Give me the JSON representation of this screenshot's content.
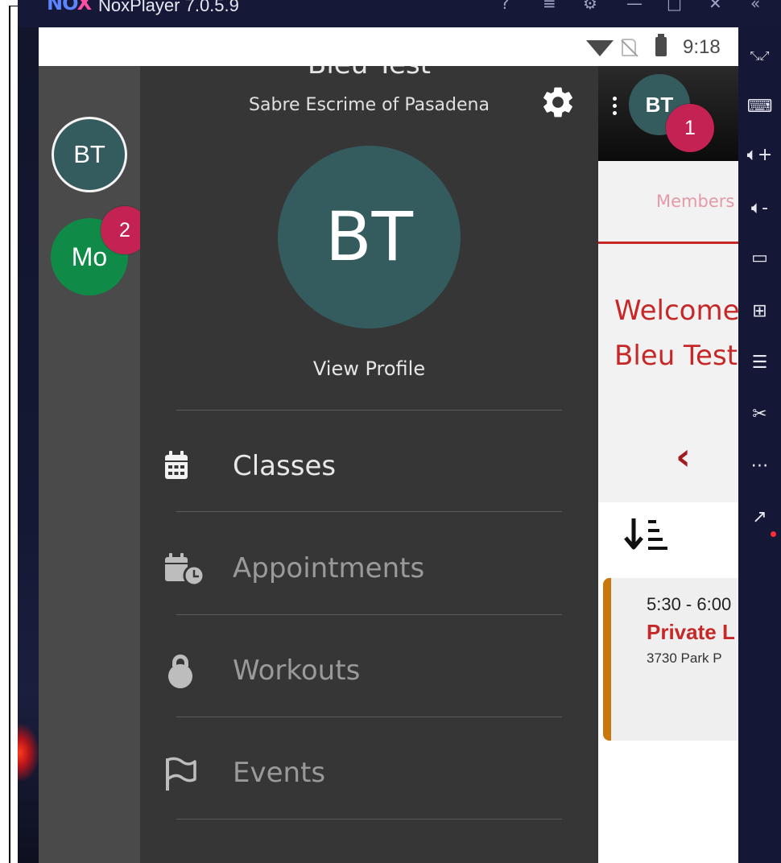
{
  "window": {
    "app_title": "NoxPlayer 7.0.5.9"
  },
  "status_bar": {
    "time": "9:18"
  },
  "accounts": [
    {
      "initials": "BT",
      "color": "#345b5e"
    },
    {
      "initials": "Mo",
      "color": "#0f8a47",
      "badge": "2"
    }
  ],
  "drawer": {
    "user_name": "Bleu Test",
    "organization": "Sabre Escrime of Pasadena",
    "avatar_initials": "BT",
    "view_profile": "View Profile",
    "menu": [
      {
        "label": "Classes",
        "icon": "calendar-icon",
        "active": true
      },
      {
        "label": "Appointments",
        "icon": "calendar-clock-icon",
        "active": false
      },
      {
        "label": "Workouts",
        "icon": "kettlebell-icon",
        "active": false
      },
      {
        "label": "Events",
        "icon": "flag-icon",
        "active": false
      }
    ]
  },
  "header": {
    "avatar_initials": "BT",
    "notification_count": "1"
  },
  "page": {
    "tab_label": "Members",
    "welcome_line1": "Welcome",
    "welcome_line2": "Bleu Test",
    "schedule_item": {
      "time": "5:30 - 6:00",
      "title": "Private L",
      "address": "3730 Park P"
    }
  },
  "colors": {
    "accent_red": "#c62828",
    "badge_pink": "#c42253",
    "avatar_teal": "#345b5e",
    "drawer_bg": "#363636"
  }
}
